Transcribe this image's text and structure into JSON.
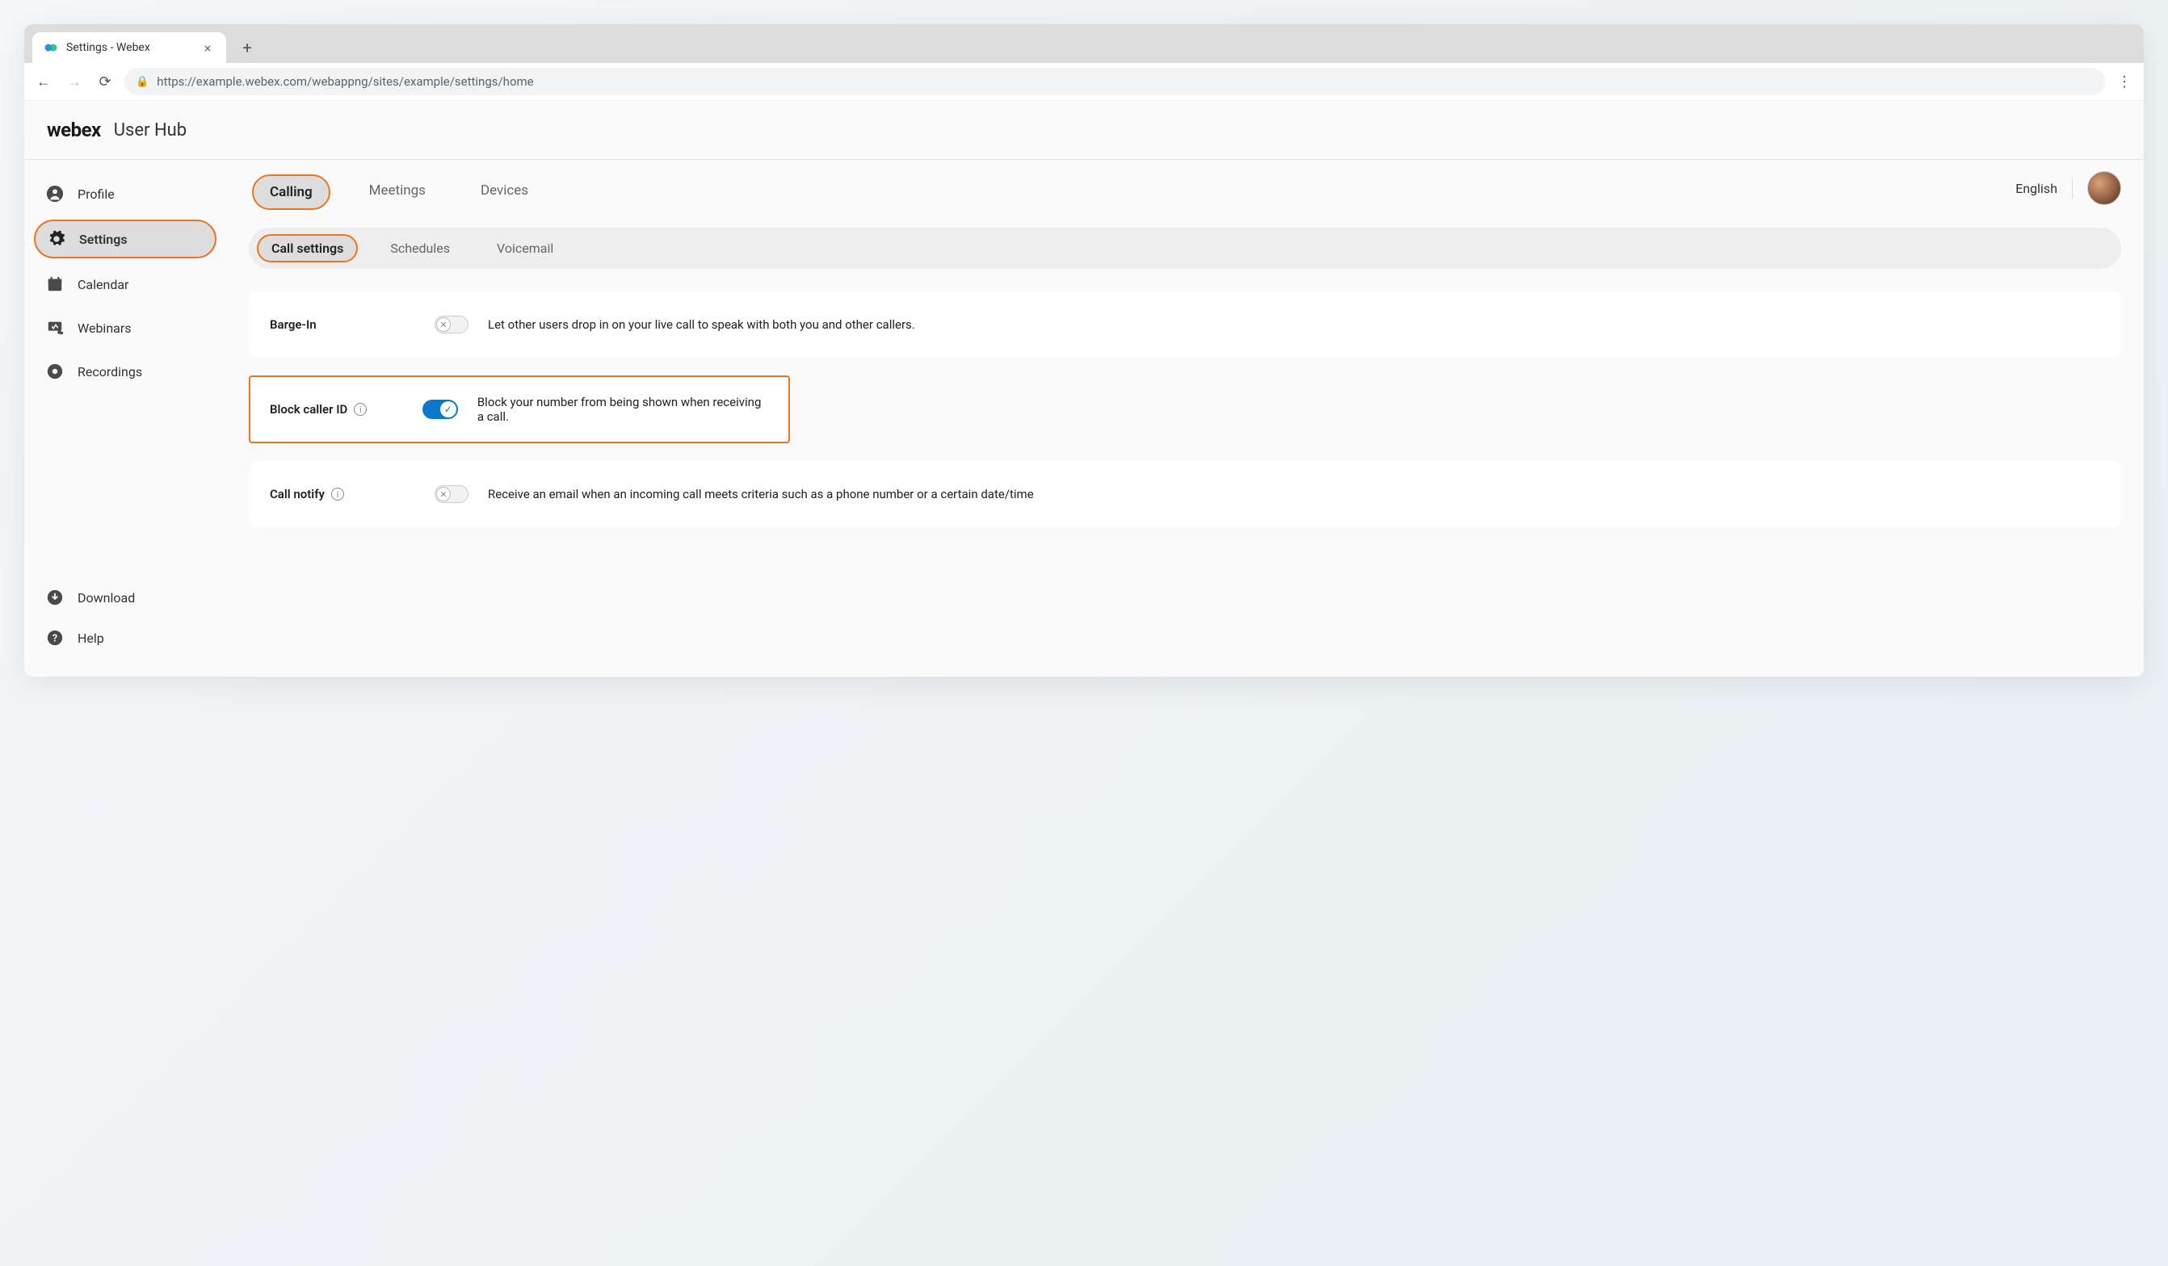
{
  "browser": {
    "tab_title": "Settings - Webex",
    "url": "https://example.webex.com/webappng/sites/example/settings/home"
  },
  "header": {
    "logo": "webex",
    "product": "User Hub"
  },
  "top": {
    "language": "English"
  },
  "sidebar": {
    "items": [
      {
        "label": "Profile"
      },
      {
        "label": "Settings"
      },
      {
        "label": "Calendar"
      },
      {
        "label": "Webinars"
      },
      {
        "label": "Recordings"
      }
    ],
    "footer": [
      {
        "label": "Download"
      },
      {
        "label": "Help"
      }
    ]
  },
  "tabs_primary": [
    {
      "label": "Calling"
    },
    {
      "label": "Meetings"
    },
    {
      "label": "Devices"
    }
  ],
  "subtabs": [
    {
      "label": "Call settings"
    },
    {
      "label": "Schedules"
    },
    {
      "label": "Voicemail"
    }
  ],
  "settings": {
    "barge_in": {
      "label": "Barge-In",
      "enabled": false,
      "desc": "Let other users drop in on your live call to speak with both you and other callers."
    },
    "block_caller_id": {
      "label": "Block caller ID",
      "enabled": true,
      "desc": "Block your number from being shown when receiving a call."
    },
    "call_notify": {
      "label": "Call notify",
      "enabled": false,
      "desc": "Receive an email when an incoming call meets criteria such as a phone number or a certain date/time"
    }
  }
}
